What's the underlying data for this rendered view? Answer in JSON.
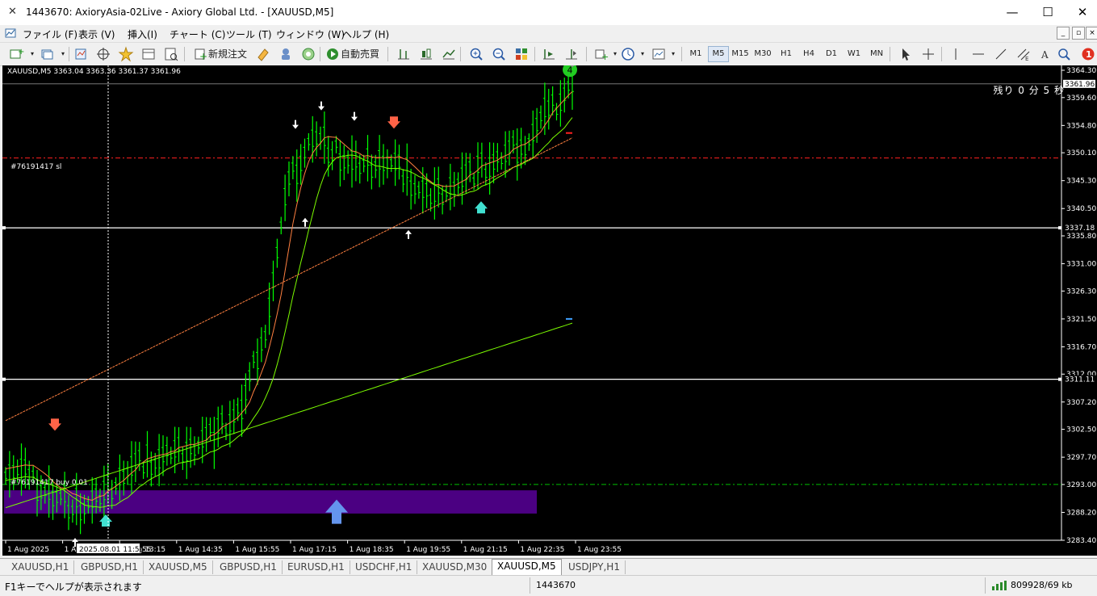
{
  "window": {
    "title": "1443670: AxioryAsia-02Live - Axiory Global Ltd. - [XAUUSD,M5]",
    "minimize": "—",
    "maximize": "☐",
    "close": "✕"
  },
  "menu": {
    "items": [
      "ファイル (F)",
      "表示 (V)",
      "挿入(I)",
      "チャート (C)",
      "ツール (T)",
      "ウィンドウ (W)",
      "ヘルプ (H)"
    ]
  },
  "toolbar": {
    "new_order": "新規注文",
    "auto_trade": "自動売買",
    "timeframes": [
      "M1",
      "M5",
      "M15",
      "M30",
      "H1",
      "H4",
      "D1",
      "W1",
      "MN"
    ],
    "active_timeframe": "M5",
    "notification_count": "1"
  },
  "chart": {
    "symbol_info": "XAUUSD,M5  3363.04 3363.36 3361.37 3361.96",
    "timer_text": "残り 0 分 5 秒",
    "sl_label": "#76191417 sl",
    "buy_label": "#76191417 buy 0.01",
    "signal_badge": "4",
    "crosshair_time": "2025.08.01 11:55",
    "current_price": "3361.96",
    "hline_prices": [
      "3337.18",
      "3311.11"
    ],
    "colors": {
      "background": "#000000",
      "candles": "#00ff00",
      "ma_fast": "#ff8040",
      "ma_mid": "#ff2020",
      "ma_slow": "#7cfc00",
      "band_fill": "#4b0082",
      "sl_line": "#ff2020",
      "buy_line": "#00c000"
    }
  },
  "chart_data": {
    "type": "line",
    "symbol": "XAUUSD",
    "timeframe": "M5",
    "ylim": [
      3283.4,
      3364.3
    ],
    "y_ticks": [
      "3364.30",
      "3359.60",
      "3354.80",
      "3350.10",
      "3345.30",
      "3340.50",
      "3335.80",
      "3331.00",
      "3326.30",
      "3321.50",
      "3316.70",
      "3312.00",
      "3307.20",
      "3302.50",
      "3297.70",
      "3293.00",
      "3288.20",
      "3283.40"
    ],
    "x_ticks": [
      "1 Aug 2025",
      "1 Aug",
      "1 Aug 13:15",
      "1 Aug 14:35",
      "1 Aug 15:55",
      "1 Aug 17:15",
      "1 Aug 18:35",
      "1 Aug 19:55",
      "1 Aug 21:15",
      "1 Aug 22:35",
      "1 Aug 23:55"
    ],
    "x_tick_suffix": "55",
    "series": [
      {
        "values": [
          3296,
          3294,
          3291,
          3289,
          3290,
          3295,
          3297,
          3298,
          3300,
          3302,
          3306,
          3320,
          3345,
          3353,
          3350,
          3347,
          3349,
          3346,
          3342,
          3345,
          3347,
          3349,
          3352,
          3357,
          3362
        ]
      }
    ],
    "levels": {
      "stop_loss": 3349.2,
      "buy_entry": 3293.0,
      "hline_1": 3337.18,
      "hline_2": 3311.11,
      "current": 3361.96
    }
  },
  "tabs": [
    "XAUUSD,H1",
    "GBPUSD,H1",
    "XAUUSD,M5",
    "GBPUSD,H1",
    "EURUSD,H1",
    "USDCHF,H1",
    "XAUUSD,M30",
    "XAUUSD,M5",
    "USDJPY,H1"
  ],
  "active_tab_index": 7,
  "status": {
    "help_text": "F1キーでヘルプが表示されます",
    "account": "1443670",
    "traffic": "809928/69 kb"
  }
}
